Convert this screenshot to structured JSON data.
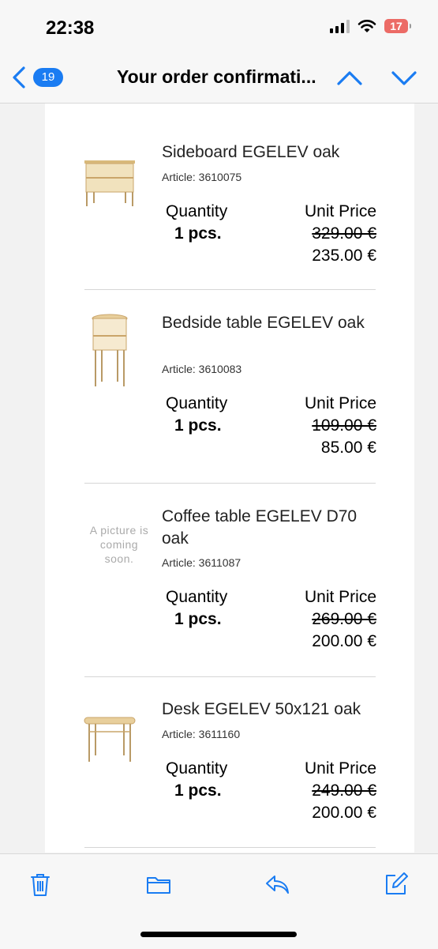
{
  "status": {
    "time": "22:38",
    "battery": "17"
  },
  "nav": {
    "unread_count": "19",
    "title": "Your order confirmati..."
  },
  "items": [
    {
      "name": "Sideboard EGELEV oak",
      "article": "Article: 3610075",
      "qty_label": "Quantity",
      "qty": "1 pcs.",
      "price_label": "Unit Price",
      "old_price": "329.00 €",
      "new_price": "235.00 €"
    },
    {
      "name": "Bedside table EGELEV oak",
      "article": "Article: 3610083",
      "qty_label": "Quantity",
      "qty": "1 pcs.",
      "price_label": "Unit Price",
      "old_price": "109.00 €",
      "new_price": "85.00 €"
    },
    {
      "name": "Coffee table EGELEV D70 oak",
      "article": "Article: 3611087",
      "qty_label": "Quantity",
      "qty": "1 pcs.",
      "price_label": "Unit Price",
      "old_price": "269.00 €",
      "new_price": "200.00 €",
      "placeholder": "A picture is coming soon."
    },
    {
      "name": "Desk EGELEV 50x121 oak",
      "article": "Article: 3611160",
      "qty_label": "Quantity",
      "qty": "1 pcs.",
      "price_label": "Unit Price",
      "old_price": "249.00 €",
      "new_price": "200.00 €"
    }
  ],
  "toolbar": {
    "icons": [
      "trash-icon",
      "folder-icon",
      "reply-icon",
      "compose-icon"
    ]
  },
  "colors": {
    "accent": "#1a7cf2",
    "battery": "#ec6b66"
  }
}
